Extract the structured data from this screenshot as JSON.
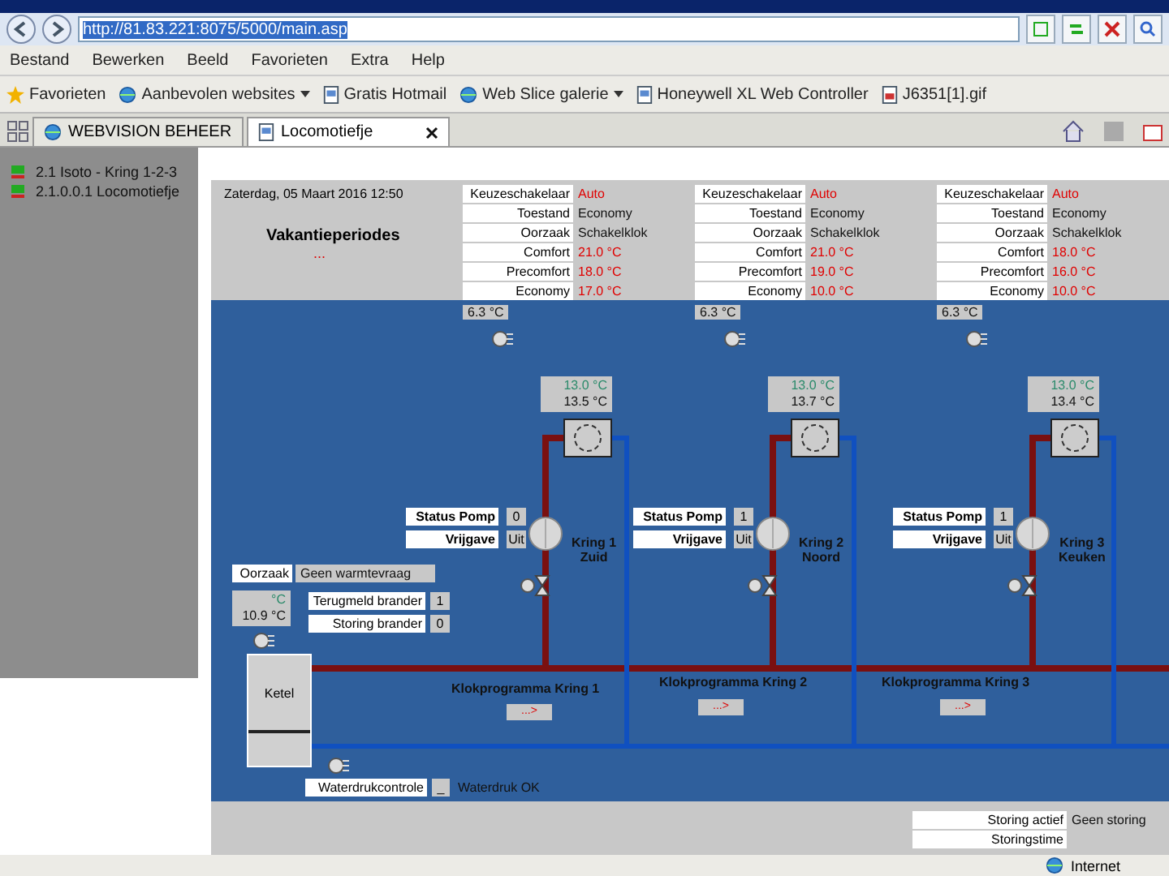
{
  "browser": {
    "url": "http://81.83.221:8075/5000/main.asp",
    "menu": [
      "Bestand",
      "Bewerken",
      "Beeld",
      "Favorieten",
      "Extra",
      "Help"
    ],
    "favorites": [
      {
        "label": "Favorieten",
        "kind": "star",
        "dropdown": false
      },
      {
        "label": "Aanbevolen websites",
        "kind": "globe",
        "dropdown": true
      },
      {
        "label": "Gratis Hotmail",
        "kind": "page",
        "dropdown": false
      },
      {
        "label": "Web Slice galerie",
        "kind": "globe",
        "dropdown": true
      },
      {
        "label": "Honeywell XL Web Controller",
        "kind": "page",
        "dropdown": false
      },
      {
        "label": "J6351[1].gif",
        "kind": "file",
        "dropdown": false
      }
    ],
    "tabs": [
      {
        "label": "WEBVISION BEHEER",
        "selected": false
      },
      {
        "label": "Locomotiefje",
        "selected": true
      }
    ]
  },
  "sidebar": {
    "items": [
      "2.1 Isoto - Kring 1-2-3",
      "2.1.0.0.1 Locomotiefje"
    ]
  },
  "page": {
    "date": "Zaterdag, 05 Maart 2016 12:50",
    "holidays": {
      "title": "Vakantieperiodes",
      "value": "..."
    },
    "zones": [
      {
        "outdoor": "6.3 °C",
        "rows": [
          {
            "label": "Keuzeschakelaar",
            "value": "Auto",
            "kind": "setting"
          },
          {
            "label": "Toestand",
            "value": "Economy",
            "kind": "state"
          },
          {
            "label": "Oorzaak",
            "value": "Schakelklok",
            "kind": "state"
          },
          {
            "label": "Comfort",
            "value": "21.0 °C",
            "kind": "setting"
          },
          {
            "label": "Precomfort",
            "value": "18.0 °C",
            "kind": "setting"
          },
          {
            "label": "Economy",
            "value": "17.0 °C",
            "kind": "setting"
          }
        ]
      },
      {
        "outdoor": "6.3 °C",
        "rows": [
          {
            "label": "Keuzeschakelaar",
            "value": "Auto",
            "kind": "setting"
          },
          {
            "label": "Toestand",
            "value": "Economy",
            "kind": "state"
          },
          {
            "label": "Oorzaak",
            "value": "Schakelklok",
            "kind": "state"
          },
          {
            "label": "Comfort",
            "value": "21.0 °C",
            "kind": "setting"
          },
          {
            "label": "Precomfort",
            "value": "19.0 °C",
            "kind": "setting"
          },
          {
            "label": "Economy",
            "value": "10.0 °C",
            "kind": "setting"
          }
        ]
      },
      {
        "outdoor": "6.3 °C",
        "rows": [
          {
            "label": "Keuzeschakelaar",
            "value": "Auto",
            "kind": "setting"
          },
          {
            "label": "Toestand",
            "value": "Economy",
            "kind": "state"
          },
          {
            "label": "Oorzaak",
            "value": "Schakelklok",
            "kind": "state"
          },
          {
            "label": "Comfort",
            "value": "18.0 °C",
            "kind": "setting"
          },
          {
            "label": "Precomfort",
            "value": "16.0 °C",
            "kind": "setting"
          },
          {
            "label": "Economy",
            "value": "10.0 °C",
            "kind": "setting"
          }
        ]
      }
    ],
    "circuits": [
      {
        "setpoint": "13.0 °C",
        "actual": "13.5 °C",
        "pump_label": "Status Pomp",
        "pump_value": "0",
        "release_label": "Vrijgave",
        "release_value": "Uit",
        "name": "Kring 1",
        "area": "Zuid"
      },
      {
        "setpoint": "13.0 °C",
        "actual": "13.7 °C",
        "pump_label": "Status Pomp",
        "pump_value": "1",
        "release_label": "Vrijgave",
        "release_value": "Uit",
        "name": "Kring 2",
        "area": "Noord"
      },
      {
        "setpoint": "13.0 °C",
        "actual": "13.4 °C",
        "pump_label": "Status Pomp",
        "pump_value": "1",
        "release_label": "Vrijgave",
        "release_value": "Uit",
        "name": "Kring 3",
        "area": "Keuken"
      }
    ],
    "boiler": {
      "cause_label": "Oorzaak",
      "cause_value": "Geen warmtevraag",
      "setpoint": "°C",
      "actual": "10.9 °C",
      "name": "Ketel",
      "rows": [
        {
          "label": "Terugmeld brander",
          "value": "1"
        },
        {
          "label": "Storing brander",
          "value": "0"
        }
      ]
    },
    "clock_programs": [
      {
        "label": "Klokprogramma Kring 1",
        "button": "...>"
      },
      {
        "label": "Klokprogramma Kring 2",
        "button": "...>"
      },
      {
        "label": "Klokprogramma Kring 3",
        "button": "...>"
      }
    ],
    "water": {
      "label": "Waterdrukcontrole",
      "button": "_",
      "status": "Waterdruk OK"
    },
    "faults": [
      {
        "label": "Storing actief",
        "value": "Geen storing"
      },
      {
        "label": "Storingstime"
      }
    ]
  },
  "status_bar": {
    "zone": "Internet"
  }
}
